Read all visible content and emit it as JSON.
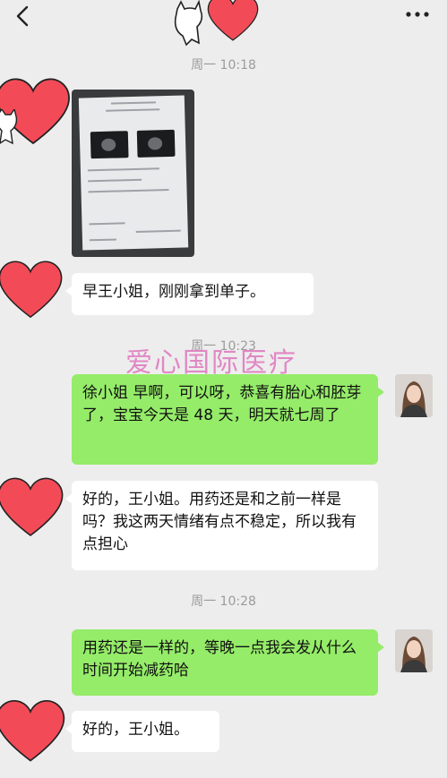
{
  "messages": [
    {
      "time": "周一 10:18"
    },
    {
      "text": "早王小姐，刚刚拿到单子。"
    },
    {
      "time": "周一 10:23"
    },
    {
      "text": "徐小姐 早啊，可以呀，恭喜有胎心和胚芽了，宝宝今天是 48 天，明天就七周了"
    },
    {
      "text": "好的，王小姐。用药还是和之前一样是吗？我这两天情绪有点不稳定，所以我有点担心"
    },
    {
      "time": "周一 10:28"
    },
    {
      "text": "用药还是一样的，等晚一点我会发从什么时间开始减药哈"
    },
    {
      "text": "好的，王小姐。"
    }
  ],
  "watermark": "爱心国际医疗",
  "colors": {
    "background": "#ededed",
    "outgoing_bubble": "#95ec69",
    "incoming_bubble": "#ffffff",
    "heart": "#f24b57",
    "watermark": "#e07cc0"
  },
  "icons": {
    "back": "chevron-left-icon",
    "more": "more-dots-icon"
  }
}
